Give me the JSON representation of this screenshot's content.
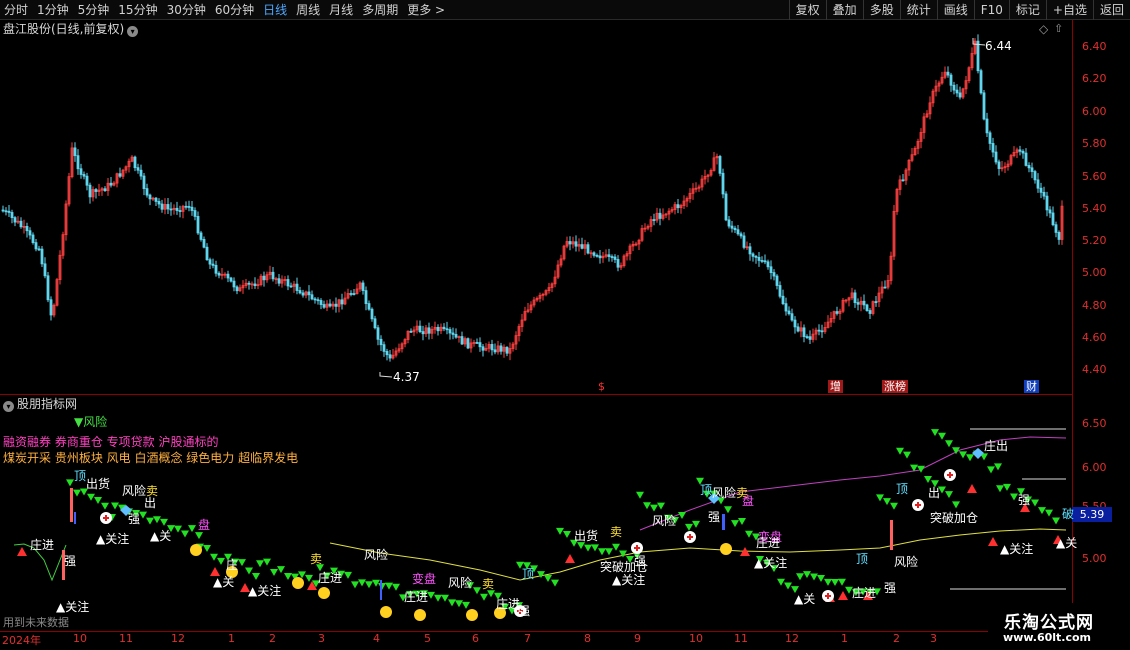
{
  "toolbar": {
    "periods": [
      "分时",
      "1分钟",
      "5分钟",
      "15分钟",
      "30分钟",
      "60分钟",
      "日线",
      "周线",
      "月线",
      "多周期",
      "更多 >"
    ],
    "active_period": "日线",
    "tools": [
      "复权",
      "叠加",
      "多股",
      "统计",
      "画线",
      "F10",
      "标记",
      "+自选",
      "返回"
    ]
  },
  "price_panel": {
    "title": "盘江股份(日线,前复权)",
    "title_icon": "chevron-down-icon",
    "right_icon": "diamond-icon",
    "high_label": "6.44",
    "low_label": "4.37",
    "axis_ticks": [
      "6.40",
      "6.20",
      "6.00",
      "5.80",
      "5.60",
      "5.40",
      "5.20",
      "5.00",
      "4.80",
      "4.60",
      "4.40"
    ],
    "event_tags": [
      {
        "text": "$",
        "color": "#ff3030"
      },
      {
        "text": "增",
        "color": "#ffffff",
        "bg": "#a01818"
      },
      {
        "text": "涨榜",
        "color": "#ffffff",
        "bg": "#a01818"
      },
      {
        "text": "财",
        "color": "#ffffff",
        "bg": "#1040c0"
      }
    ]
  },
  "indicator_panel": {
    "title": "股朋指标网",
    "title_icon": "chevron-down-icon",
    "risk_label": "▼风险",
    "line1": "融资融券 券商重仓 专项贷款 沪股通标的",
    "line2": "煤炭开采 贵州板块 风电 白酒概念 绿色电力 超临界发电",
    "axis_ticks": [
      "6.50",
      "6.00",
      "5.50",
      "5.00"
    ],
    "current_price": "5.39",
    "annotations": [
      {
        "text": "庄进",
        "cls": "ann-white"
      },
      {
        "text": "强",
        "cls": "ann-white"
      },
      {
        "text": "▲关注",
        "cls": "ann-white"
      },
      {
        "text": "顶",
        "cls": "ann-cyan"
      },
      {
        "text": "出货",
        "cls": "ann-white"
      },
      {
        "text": "风险",
        "cls": "ann-white"
      },
      {
        "text": "卖",
        "cls": "ann-yellow"
      },
      {
        "text": "出",
        "cls": "ann-white"
      },
      {
        "text": "强",
        "cls": "ann-white"
      },
      {
        "text": "▲关注",
        "cls": "ann-white"
      },
      {
        "text": "▲关",
        "cls": "ann-white"
      },
      {
        "text": "盘",
        "cls": "ann-magenta"
      },
      {
        "text": "庄",
        "cls": "ann-white"
      },
      {
        "text": "▲关",
        "cls": "ann-white"
      },
      {
        "text": "▲关注",
        "cls": "ann-white"
      },
      {
        "text": "卖",
        "cls": "ann-yellow"
      },
      {
        "text": "庄进",
        "cls": "ann-white"
      },
      {
        "text": "风险",
        "cls": "ann-white"
      },
      {
        "text": "变盘",
        "cls": "ann-magenta"
      },
      {
        "text": "风险",
        "cls": "ann-white"
      },
      {
        "text": "卖",
        "cls": "ann-yellow"
      },
      {
        "text": "庄进",
        "cls": "ann-white"
      },
      {
        "text": "庄进",
        "cls": "ann-white"
      },
      {
        "text": "强",
        "cls": "ann-white"
      },
      {
        "text": "顶",
        "cls": "ann-cyan"
      },
      {
        "text": "出货",
        "cls": "ann-white"
      },
      {
        "text": "卖",
        "cls": "ann-yellow"
      },
      {
        "text": "风险",
        "cls": "ann-white"
      },
      {
        "text": "强",
        "cls": "ann-white"
      },
      {
        "text": "突破加仓",
        "cls": "ann-white"
      },
      {
        "text": "▲关注",
        "cls": "ann-white"
      },
      {
        "text": "顶",
        "cls": "ann-cyan"
      },
      {
        "text": "风险",
        "cls": "ann-white"
      },
      {
        "text": "卖",
        "cls": "ann-yellow"
      },
      {
        "text": "盘",
        "cls": "ann-magenta"
      },
      {
        "text": "强",
        "cls": "ann-white"
      },
      {
        "text": "变盘",
        "cls": "ann-magenta"
      },
      {
        "text": "庄进",
        "cls": "ann-white"
      },
      {
        "text": "▲关注",
        "cls": "ann-white"
      },
      {
        "text": "▲关",
        "cls": "ann-white"
      },
      {
        "text": "庄进",
        "cls": "ann-white"
      },
      {
        "text": "顶",
        "cls": "ann-cyan"
      },
      {
        "text": "风险",
        "cls": "ann-white"
      },
      {
        "text": "强",
        "cls": "ann-white"
      },
      {
        "text": "顶",
        "cls": "ann-cyan"
      },
      {
        "text": "出",
        "cls": "ann-white"
      },
      {
        "text": "突破加仓",
        "cls": "ann-white"
      },
      {
        "text": "庄出",
        "cls": "ann-white"
      },
      {
        "text": "强",
        "cls": "ann-white"
      },
      {
        "text": "▲关注",
        "cls": "ann-white"
      },
      {
        "text": "破",
        "cls": "ann-cyan"
      },
      {
        "text": "▲关",
        "cls": "ann-white"
      }
    ]
  },
  "date_axis": {
    "labels": [
      "2024年",
      "10",
      "11",
      "12",
      "1",
      "2",
      "3",
      "4",
      "5",
      "6",
      "7",
      "8",
      "9",
      "10",
      "11",
      "12",
      "1",
      "2",
      "3"
    ]
  },
  "footer_note": "用到未来数据",
  "watermark": {
    "name": "乐淘公式网",
    "url": "www.60lt.com"
  }
}
